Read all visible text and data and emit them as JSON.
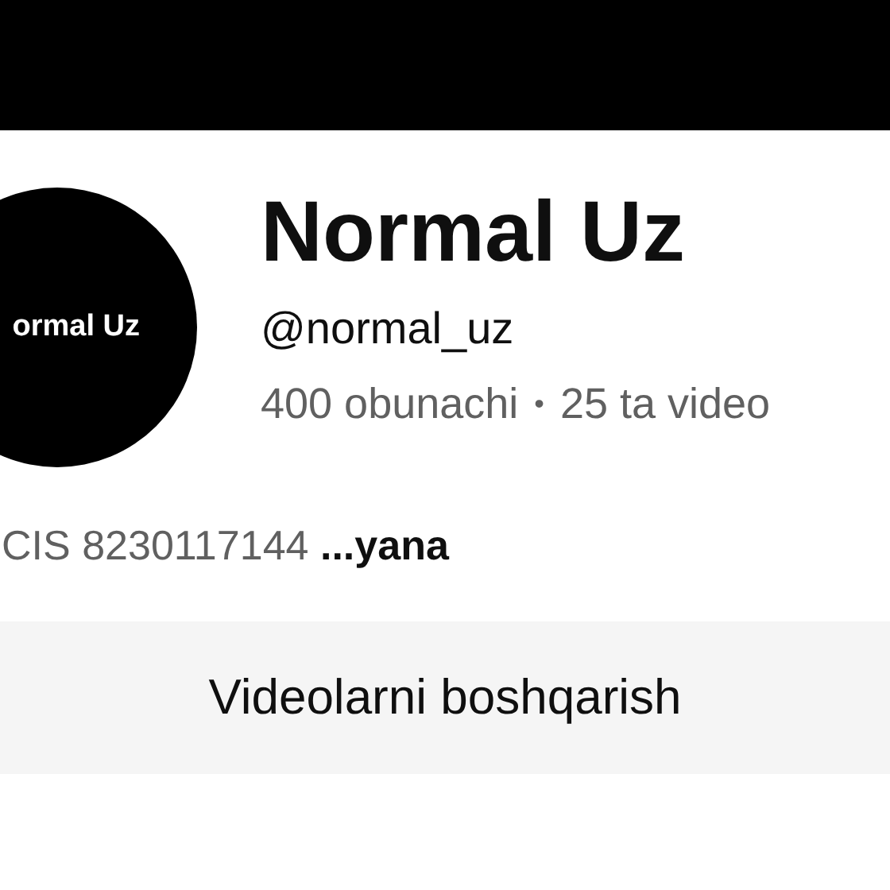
{
  "channel": {
    "avatar_text": "ormal Uz",
    "name": "Normal Uz",
    "handle": "@normal_uz",
    "subscribers": "400 obunachi",
    "separator": "•",
    "videos": "25 ta video",
    "description": "CIS 8230117144",
    "more": "...yana"
  },
  "buttons": [
    "Videolarni boshqarish"
  ]
}
